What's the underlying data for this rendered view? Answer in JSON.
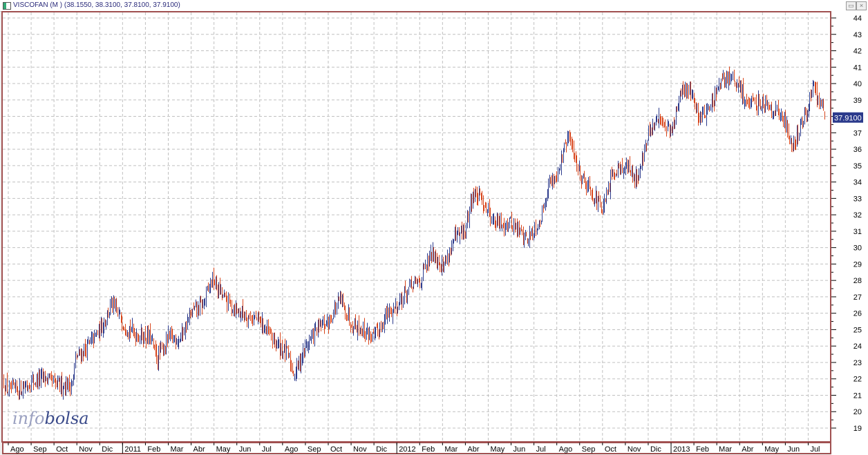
{
  "window": {
    "title": "VISCOFAN (M ) (38.1550, 38.3100, 37.8100, 37.9100)",
    "restore_icon": "restore-icon",
    "close_icon": "close-icon"
  },
  "logo": {
    "part1": "info",
    "part2": "bolsa"
  },
  "colors": {
    "up": "#2b3a8c",
    "down": "#d8441a",
    "frame": "#a05050",
    "grid": "#c0c0c0",
    "last_bg": "#2b3a8c"
  },
  "chart_data": {
    "type": "ohlc",
    "title": "VISCOFAN (M )",
    "last_values": {
      "open": 38.155,
      "high": 38.31,
      "low": 37.81,
      "close": 37.91
    },
    "last_label": "37.9100",
    "ylim": [
      18.5,
      44.5
    ],
    "yticks": [
      19,
      20,
      21,
      22,
      23,
      24,
      25,
      26,
      27,
      28,
      29,
      30,
      31,
      32,
      33,
      34,
      35,
      36,
      37,
      38,
      39,
      40,
      41,
      42,
      43,
      44
    ],
    "ytick_labels": [
      "19",
      "20",
      "21",
      "22",
      "23",
      "24",
      "25",
      "26",
      "27",
      "28",
      "29",
      "30",
      "31",
      "32",
      "33",
      "34",
      "35",
      "36",
      "37",
      "39",
      "40",
      "41",
      "42",
      "43",
      "44"
    ],
    "xtick_labels": [
      "Ago",
      "Sep",
      "Oct",
      "Nov",
      "Dic",
      "2011",
      "Feb",
      "Mar",
      "Abr",
      "May",
      "Jun",
      "Jul",
      "Ago",
      "Sep",
      "Oct",
      "Nov",
      "Dic",
      "2012",
      "Feb",
      "Mar",
      "Abr",
      "May",
      "Jun",
      "Jul",
      "Ago",
      "Sep",
      "Oct",
      "Nov",
      "Dic",
      "2013",
      "Feb",
      "Mar",
      "Abr",
      "May",
      "Jun",
      "Jul"
    ],
    "grid": true,
    "close_path_by_month": [
      [
        -0.2,
        21.8
      ],
      [
        0,
        21.2
      ],
      [
        0.5,
        21.4
      ],
      [
        1,
        21.8
      ],
      [
        1.6,
        22.1
      ],
      [
        2,
        21.6
      ],
      [
        2.8,
        21.7
      ],
      [
        2.95,
        23.3
      ],
      [
        3.5,
        24
      ],
      [
        4,
        25
      ],
      [
        4.5,
        26.5
      ],
      [
        5,
        25.5
      ],
      [
        5.5,
        24.8
      ],
      [
        6.2,
        24.5
      ],
      [
        6.5,
        23.2
      ],
      [
        7,
        24.5
      ],
      [
        7.5,
        24.5
      ],
      [
        8,
        26
      ],
      [
        8.5,
        26.5
      ],
      [
        8.9,
        28.1
      ],
      [
        9.5,
        26.8
      ],
      [
        10,
        26.2
      ],
      [
        11,
        25.5
      ],
      [
        11.5,
        24.5
      ],
      [
        12.2,
        23.5
      ],
      [
        12.5,
        22.3
      ],
      [
        13,
        24
      ],
      [
        13.5,
        25
      ],
      [
        14,
        25.5
      ],
      [
        14.5,
        26.8
      ],
      [
        15,
        25.5
      ],
      [
        15.5,
        25
      ],
      [
        16,
        24.5
      ],
      [
        16.5,
        25.8
      ],
      [
        17,
        26.5
      ],
      [
        17.5,
        27.5
      ],
      [
        18,
        28
      ],
      [
        18.6,
        29.8
      ],
      [
        19,
        28.8
      ],
      [
        19.5,
        30.5
      ],
      [
        20,
        31
      ],
      [
        20.3,
        33.3
      ],
      [
        20.8,
        32.8
      ],
      [
        21.3,
        31.5
      ],
      [
        22,
        31.5
      ],
      [
        22.7,
        30.5
      ],
      [
        23.3,
        31.8
      ],
      [
        23.6,
        33.8
      ],
      [
        24,
        34.5
      ],
      [
        24.5,
        36.8
      ],
      [
        25,
        34.5
      ],
      [
        25.5,
        33.5
      ],
      [
        26,
        32.2
      ],
      [
        26.5,
        34.8
      ],
      [
        27,
        35
      ],
      [
        27.5,
        34.2
      ],
      [
        28,
        36.8
      ],
      [
        28.5,
        38
      ],
      [
        29,
        37
      ],
      [
        29.4,
        39.2
      ],
      [
        29.8,
        39.8
      ],
      [
        30.2,
        38
      ],
      [
        30.7,
        38.5
      ],
      [
        31,
        39.5
      ],
      [
        31.5,
        40.5
      ],
      [
        32,
        39.6
      ],
      [
        32.5,
        38.6
      ],
      [
        33,
        39
      ],
      [
        33.5,
        38.5
      ],
      [
        34,
        37.6
      ],
      [
        34.3,
        36.2
      ],
      [
        34.8,
        37.8
      ],
      [
        35.2,
        39.7
      ],
      [
        35.6,
        38.6
      ],
      [
        35.7,
        37.91
      ]
    ]
  }
}
